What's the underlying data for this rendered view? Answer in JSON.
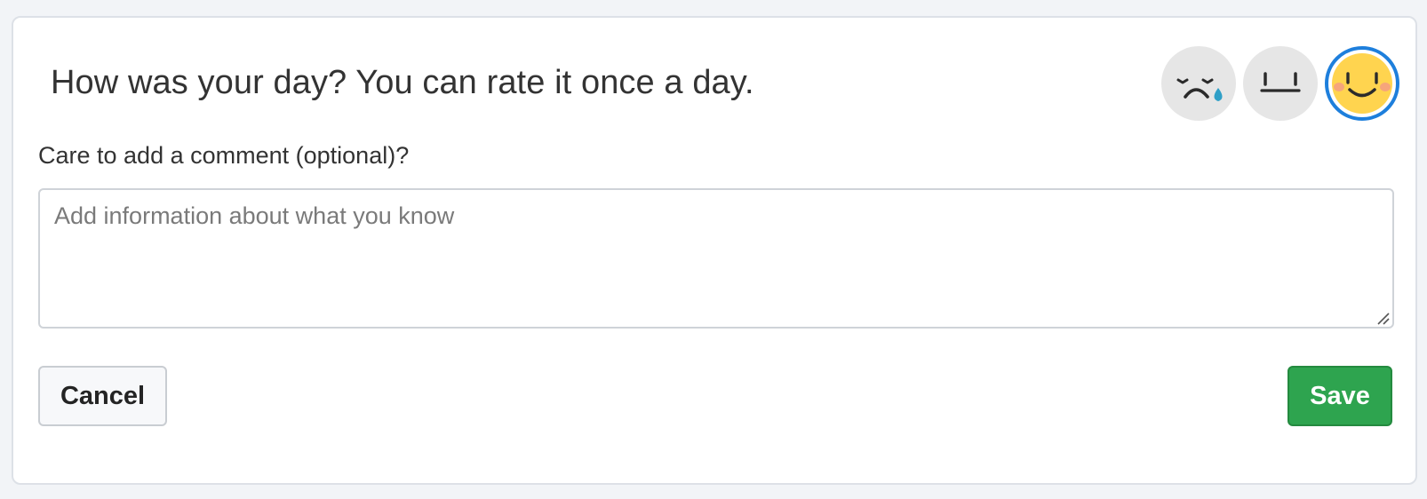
{
  "feedback": {
    "title": "How was your day? You can rate it once a day.",
    "ratings": [
      {
        "icon": "crying-face-icon",
        "selected": false
      },
      {
        "icon": "neutral-face-icon",
        "selected": false
      },
      {
        "icon": "smiling-face-icon",
        "selected": true
      }
    ],
    "comment_label": "Care to add a comment (optional)?",
    "comment_placeholder": "Add information about what you know",
    "comment_value": "",
    "cancel_label": "Cancel",
    "save_label": "Save"
  },
  "colors": {
    "page_background": "#f2f4f7",
    "card_background": "#ffffff",
    "selected_ring": "#1e7fdc",
    "save_button": "#2ea44f",
    "smile_face": "#ffd44f",
    "tear": "#2f9fc7"
  }
}
